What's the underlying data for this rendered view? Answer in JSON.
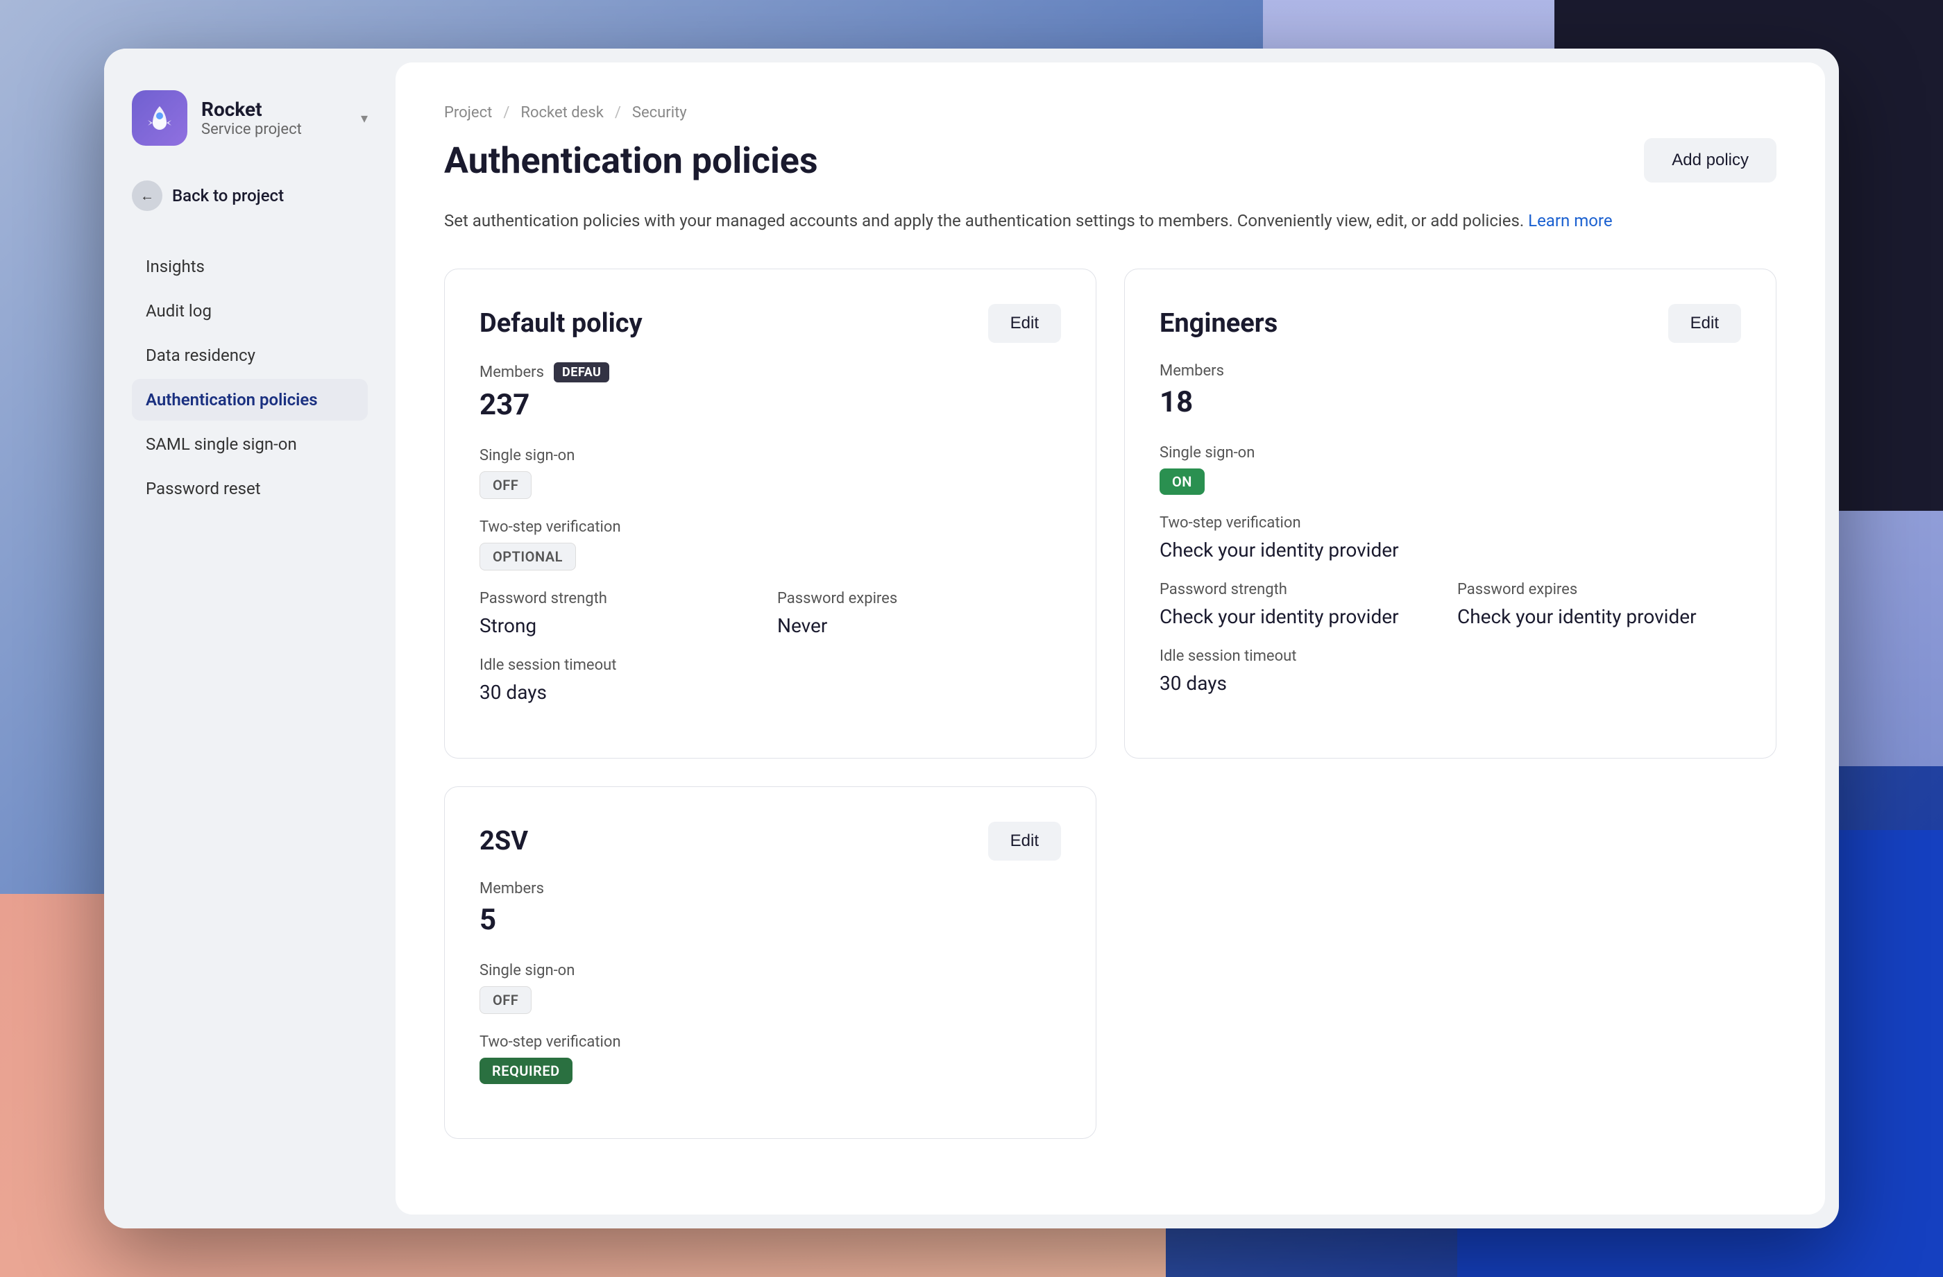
{
  "background": {
    "black_corner": true,
    "blue_corner": true
  },
  "sidebar": {
    "project_name": "Rocket",
    "project_sub": "Service project",
    "dropdown_label": "▾",
    "back_button_label": "Back to project",
    "nav_items": [
      {
        "id": "insights",
        "label": "Insights",
        "active": false
      },
      {
        "id": "audit-log",
        "label": "Audit log",
        "active": false
      },
      {
        "id": "data-residency",
        "label": "Data residency",
        "active": false
      },
      {
        "id": "authentication-policies",
        "label": "Authentication policies",
        "active": true
      },
      {
        "id": "saml-sso",
        "label": "SAML single sign-on",
        "active": false
      },
      {
        "id": "password-reset",
        "label": "Password reset",
        "active": false
      }
    ]
  },
  "breadcrumb": {
    "items": [
      "Project",
      "Rocket desk",
      "Security"
    ],
    "separators": [
      "/",
      "/"
    ]
  },
  "page": {
    "title": "Authentication policies",
    "add_button_label": "Add policy",
    "description": "Set authentication policies with your managed accounts and apply the authentication settings to members. Conveniently view, edit, or add policies.",
    "learn_more_label": "Learn more"
  },
  "policies": [
    {
      "id": "default-policy",
      "title": "Default policy",
      "edit_label": "Edit",
      "members_label": "Members",
      "members_count": "237",
      "show_default_badge": true,
      "default_badge_text": "DEFAU",
      "sso_label": "Single sign-on",
      "sso_badge": "OFF",
      "sso_badge_type": "off",
      "two_step_label": "Two-step verification",
      "two_step_badge": "OPTIONAL",
      "two_step_badge_type": "optional",
      "password_strength_label": "Password strength",
      "password_strength_value": "Strong",
      "password_expires_label": "Password expires",
      "password_expires_value": "Never",
      "idle_session_label": "Idle session timeout",
      "idle_session_value": "30 days"
    },
    {
      "id": "engineers-policy",
      "title": "Engineers",
      "edit_label": "Edit",
      "members_label": "Members",
      "members_count": "18",
      "show_default_badge": false,
      "sso_label": "Single sign-on",
      "sso_badge": "ON",
      "sso_badge_type": "on",
      "two_step_label": "Two-step verification",
      "two_step_value": "Check your identity provider",
      "password_strength_label": "Password strength",
      "password_strength_value": "Check your identity provider",
      "password_expires_label": "Password expires",
      "password_expires_value": "Check your identity provider",
      "idle_session_label": "Idle session timeout",
      "idle_session_value": "30 days"
    },
    {
      "id": "2sv-policy",
      "title": "2SV",
      "edit_label": "Edit",
      "members_label": "Members",
      "members_count": "5",
      "show_default_badge": false,
      "sso_label": "Single sign-on",
      "sso_badge": "OFF",
      "sso_badge_type": "off",
      "two_step_label": "Two-step verification",
      "two_step_badge": "REQUIRED",
      "two_step_badge_type": "required"
    }
  ]
}
